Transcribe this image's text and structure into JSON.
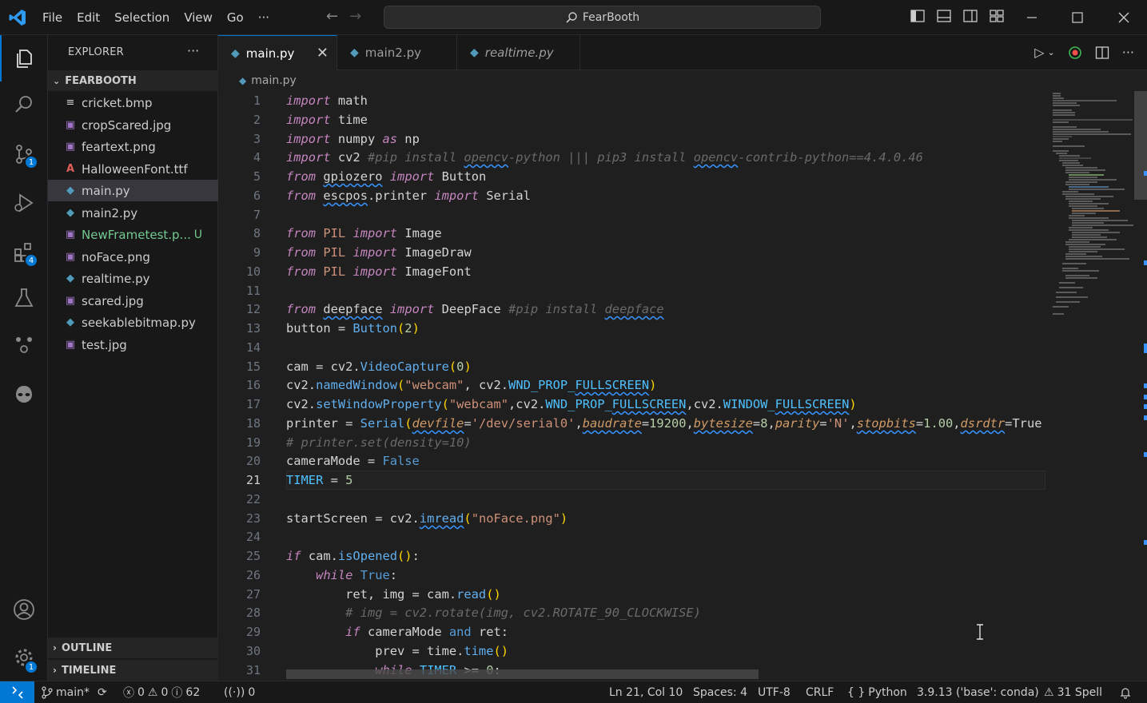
{
  "titlebar": {
    "menu": [
      "File",
      "Edit",
      "Selection",
      "View",
      "Go",
      "···"
    ],
    "search": "FearBooth",
    "nav_back": "←",
    "nav_forward": "→"
  },
  "activity_badges": {
    "source_control": "1",
    "extensions": "4",
    "manage": "1"
  },
  "sidebar": {
    "title": "EXPLORER",
    "more": "···",
    "folder": "FEARBOOTH",
    "files": [
      {
        "name": "cricket.bmp",
        "icon": "bmp-icon"
      },
      {
        "name": "cropScared.jpg",
        "icon": "image-icon"
      },
      {
        "name": "feartext.png",
        "icon": "image-icon"
      },
      {
        "name": "HalloweenFont.ttf",
        "icon": "font-icon"
      },
      {
        "name": "main.py",
        "icon": "python-icon",
        "selected": true
      },
      {
        "name": "main2.py",
        "icon": "python-icon"
      },
      {
        "name": "NewFrametest.p...",
        "icon": "image-icon",
        "status": "U"
      },
      {
        "name": "noFace.png",
        "icon": "image-icon"
      },
      {
        "name": "realtime.py",
        "icon": "python-icon"
      },
      {
        "name": "scared.jpg",
        "icon": "image-icon"
      },
      {
        "name": "seekablebitmap.py",
        "icon": "python-icon"
      },
      {
        "name": "test.jpg",
        "icon": "image-icon"
      }
    ],
    "outline": "OUTLINE",
    "timeline": "TIMELINE"
  },
  "tabs": [
    {
      "label": "main.py",
      "active": true,
      "close": "✕"
    },
    {
      "label": "main2.py"
    },
    {
      "label": "realtime.py",
      "italic": true
    }
  ],
  "breadcrumb": "main.py",
  "editor": {
    "current_line": 21,
    "line_numbers": [
      "1",
      "2",
      "3",
      "4",
      "5",
      "6",
      "7",
      "8",
      "9",
      "10",
      "11",
      "12",
      "13",
      "14",
      "15",
      "16",
      "17",
      "18",
      "19",
      "20",
      "21",
      "22",
      "23",
      "24",
      "25",
      "26",
      "27",
      "28",
      "29",
      "30",
      "31"
    ]
  },
  "statusbar": {
    "branch": "main*",
    "errors": "0",
    "warnings": "0",
    "info": "62",
    "ports": "0",
    "position": "Ln 21, Col 10",
    "spaces": "Spaces: 4",
    "encoding": "UTF-8",
    "eol": "CRLF",
    "language": "Python",
    "interpreter": "3.9.13 ('base': conda)",
    "spell": "31 Spell"
  },
  "colors": {
    "accent": "#0078d4",
    "keyword": "#c586c0",
    "function": "#61afef",
    "string": "#ce9178",
    "comment": "#6a6a6a"
  }
}
